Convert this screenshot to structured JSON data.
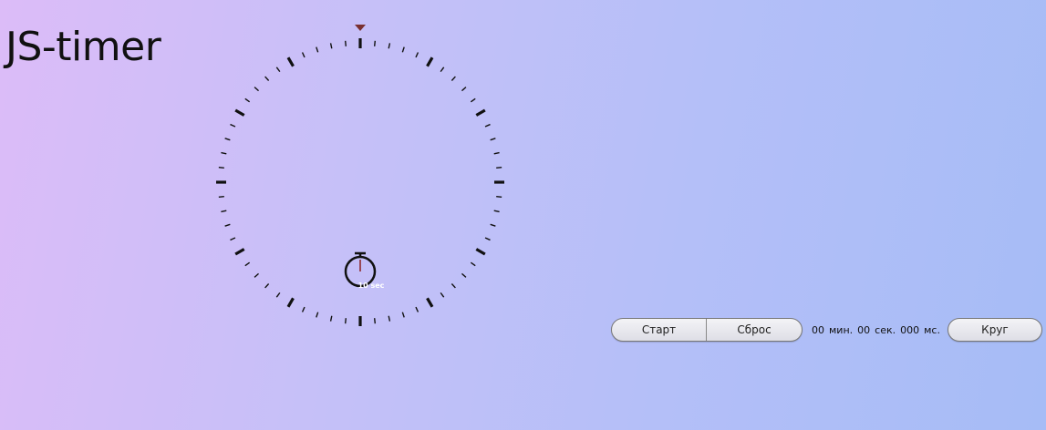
{
  "app": {
    "title": "JS-timer"
  },
  "dial": {
    "marker_color": "#7a3030",
    "tick_color": "#111111",
    "icon": "stopwatch-icon",
    "icon_label": "10 sec"
  },
  "controls": {
    "start_label": "Старт",
    "reset_label": "Сброс",
    "lap_label": "Круг"
  },
  "readout": {
    "minutes": "00",
    "minutes_unit": "мин.",
    "seconds": "00",
    "seconds_unit": "сек.",
    "milliseconds": "000",
    "milliseconds_unit": "мс."
  }
}
